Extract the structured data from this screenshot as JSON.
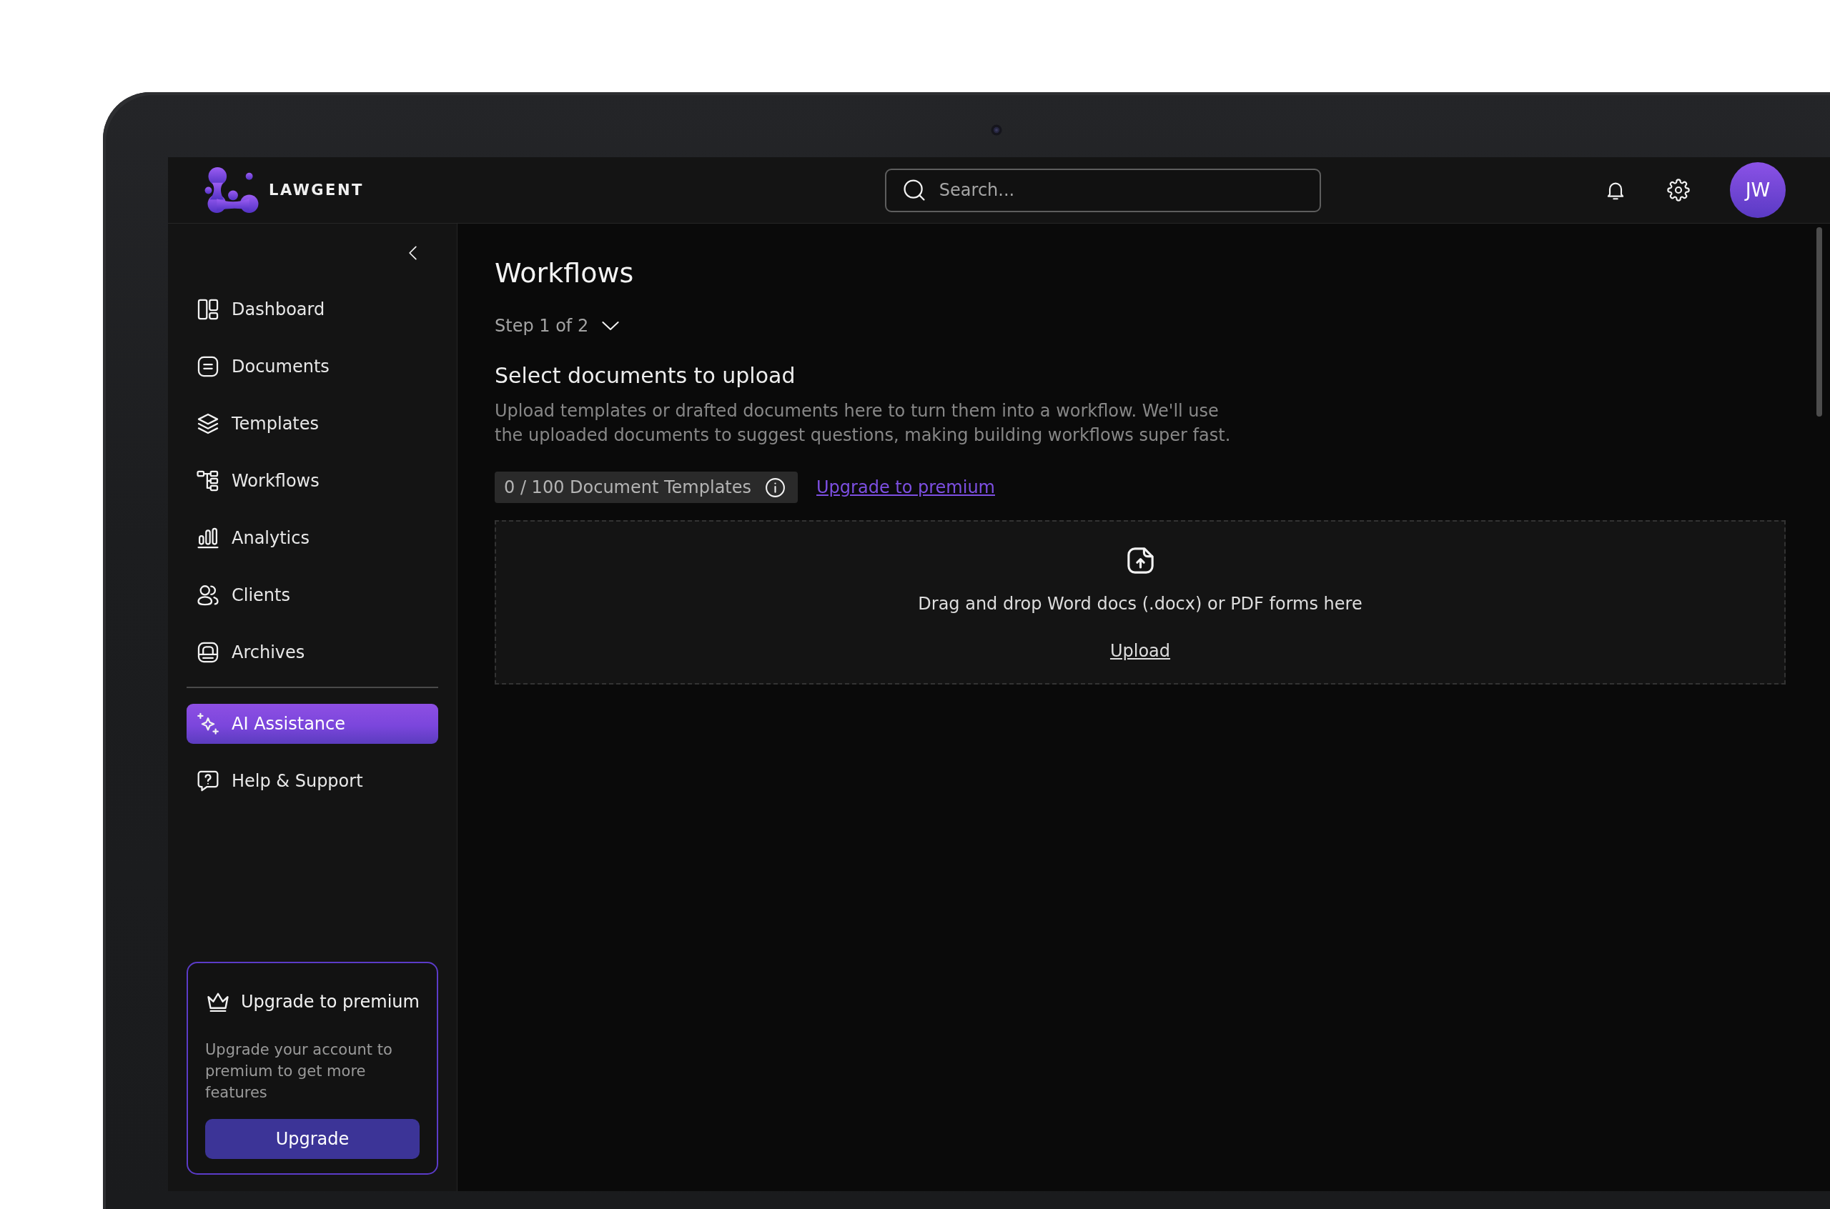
{
  "header": {
    "logo": "LAWGENT",
    "search": {
      "placeholder": "Search..."
    },
    "avatar": "JW"
  },
  "sidebar": {
    "items": [
      {
        "label": "Dashboard",
        "selected": false
      },
      {
        "label": "Documents",
        "selected": false
      },
      {
        "label": "Templates",
        "selected": false
      },
      {
        "label": "Workflows",
        "selected": false
      },
      {
        "label": "Analytics",
        "selected": false
      },
      {
        "label": "Clients",
        "selected": false
      },
      {
        "label": "Archives",
        "selected": false
      }
    ],
    "extra_items": [
      {
        "label": "AI Assistance",
        "selected": true
      },
      {
        "label": "Help & Support",
        "selected": false
      }
    ],
    "upgrade_card": {
      "title": "Upgrade to premium",
      "text": "Upgrade your account to premium to get more features",
      "button": "Upgrade"
    }
  },
  "main": {
    "title": "Workflows",
    "step": "Step 1 of 2",
    "section_title": "Select documents to upload",
    "description": "Upload templates or drafted documents here to turn them into a workflow. We'll use the uploaded documents to suggest questions, making building workflows super fast.",
    "usage": "0 / 100 Document Templates",
    "upgrade_link": "Upgrade to premium",
    "dropzone": {
      "text": "Drag and drop Word docs (.docx) or PDF forms here",
      "upload_link": "Upload"
    }
  }
}
